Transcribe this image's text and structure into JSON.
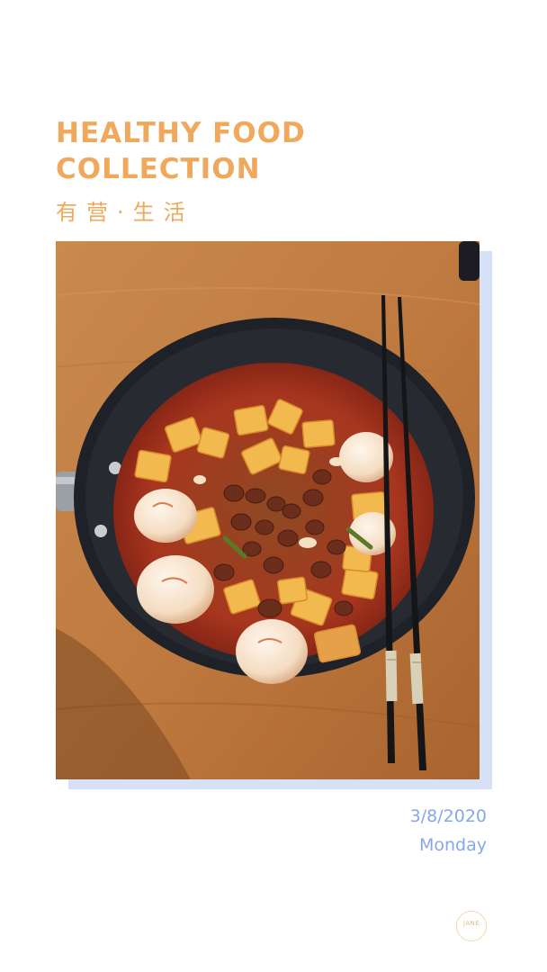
{
  "header": {
    "title_line1": "HEALTHY FOOD",
    "title_line2": "COLLECTION",
    "subtitle": "有营·生活"
  },
  "photo": {
    "subject": "food-photo"
  },
  "date": {
    "date_text": "3/8/2020",
    "weekday_text": "Monday"
  },
  "logo": {
    "text": "JANE"
  },
  "colors": {
    "accent_orange": "#f0a85c",
    "accent_blue": "#86a7ea",
    "shadow_blue": "#d6e1f8",
    "logo_gold": "#d9c18a"
  }
}
